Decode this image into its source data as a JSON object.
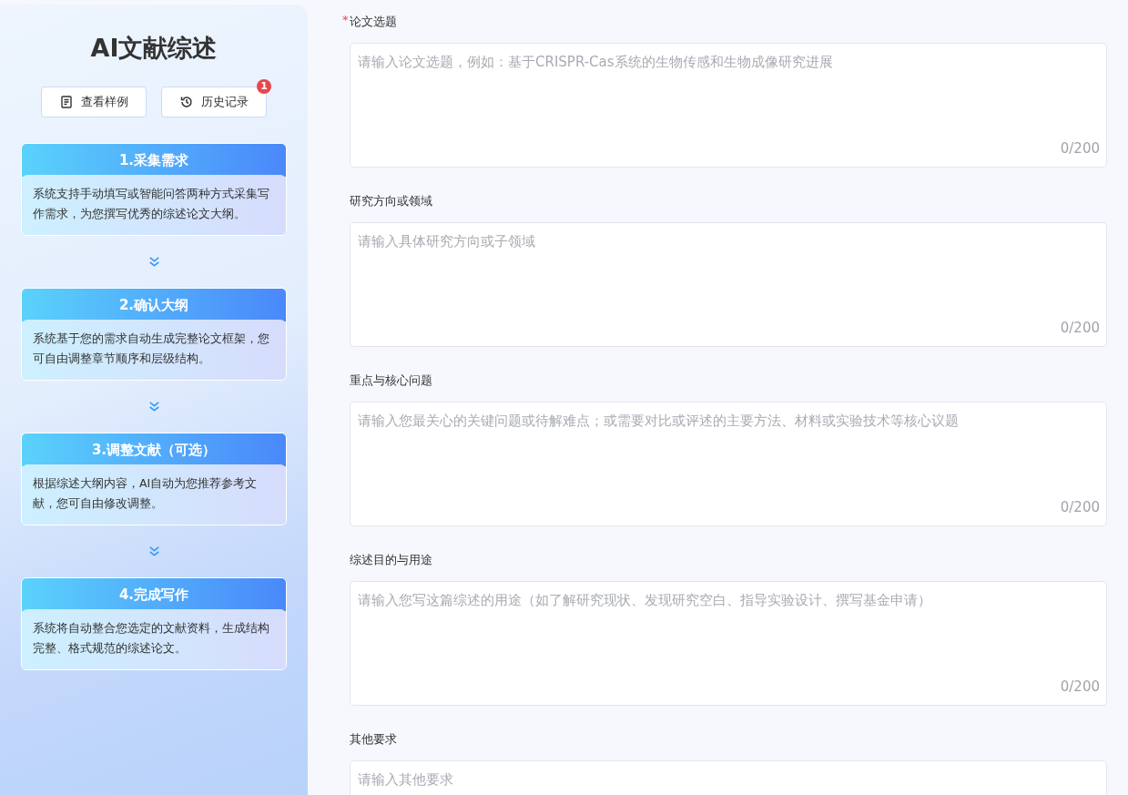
{
  "sidebar": {
    "title": "AI文献综述",
    "buttons": [
      {
        "label": "查看样例"
      },
      {
        "label": "历史记录",
        "badge": "1"
      }
    ],
    "steps": [
      {
        "title": "1.采集需求",
        "description": "系统支持手动填写或智能问答两种方式采集写作需求，为您撰写优秀的综述论文大纲。"
      },
      {
        "title": "2.确认大纲",
        "description": "系统基于您的需求自动生成完整论文框架，您可自由调整章节顺序和层级结构。"
      },
      {
        "title": "3.调整文献（可选）",
        "description": "根据综述大纲内容，AI自动为您推荐参考文献，您可自由修改调整。"
      },
      {
        "title": "4.完成写作",
        "description": "系统将自动整合您选定的文献资料，生成结构完整、格式规范的综述论文。"
      }
    ]
  },
  "form": {
    "fields": [
      {
        "label": "论文选题",
        "required_mark": "*",
        "placeholder": "请输入论文选题，例如：基于CRISPR-Cas系统的生物传感和生物成像研究进展",
        "counter": "0/200"
      },
      {
        "label": "研究方向或领域",
        "placeholder": "请输入具体研究方向或子领域",
        "counter": "0/200"
      },
      {
        "label": "重点与核心问题",
        "placeholder": "请输入您最关心的关键问题或待解难点；或需要对比或评述的主要方法、材料或实验技术等核心议题",
        "counter": "0/200"
      },
      {
        "label": "综述目的与用途",
        "placeholder": "请输入您写这篇综述的用途（如了解研究现状、发现研究空白、指导实验设计、撰写基金申请）",
        "counter": "0/200"
      },
      {
        "label": "其他要求",
        "placeholder": "请输入其他要求"
      }
    ]
  }
}
